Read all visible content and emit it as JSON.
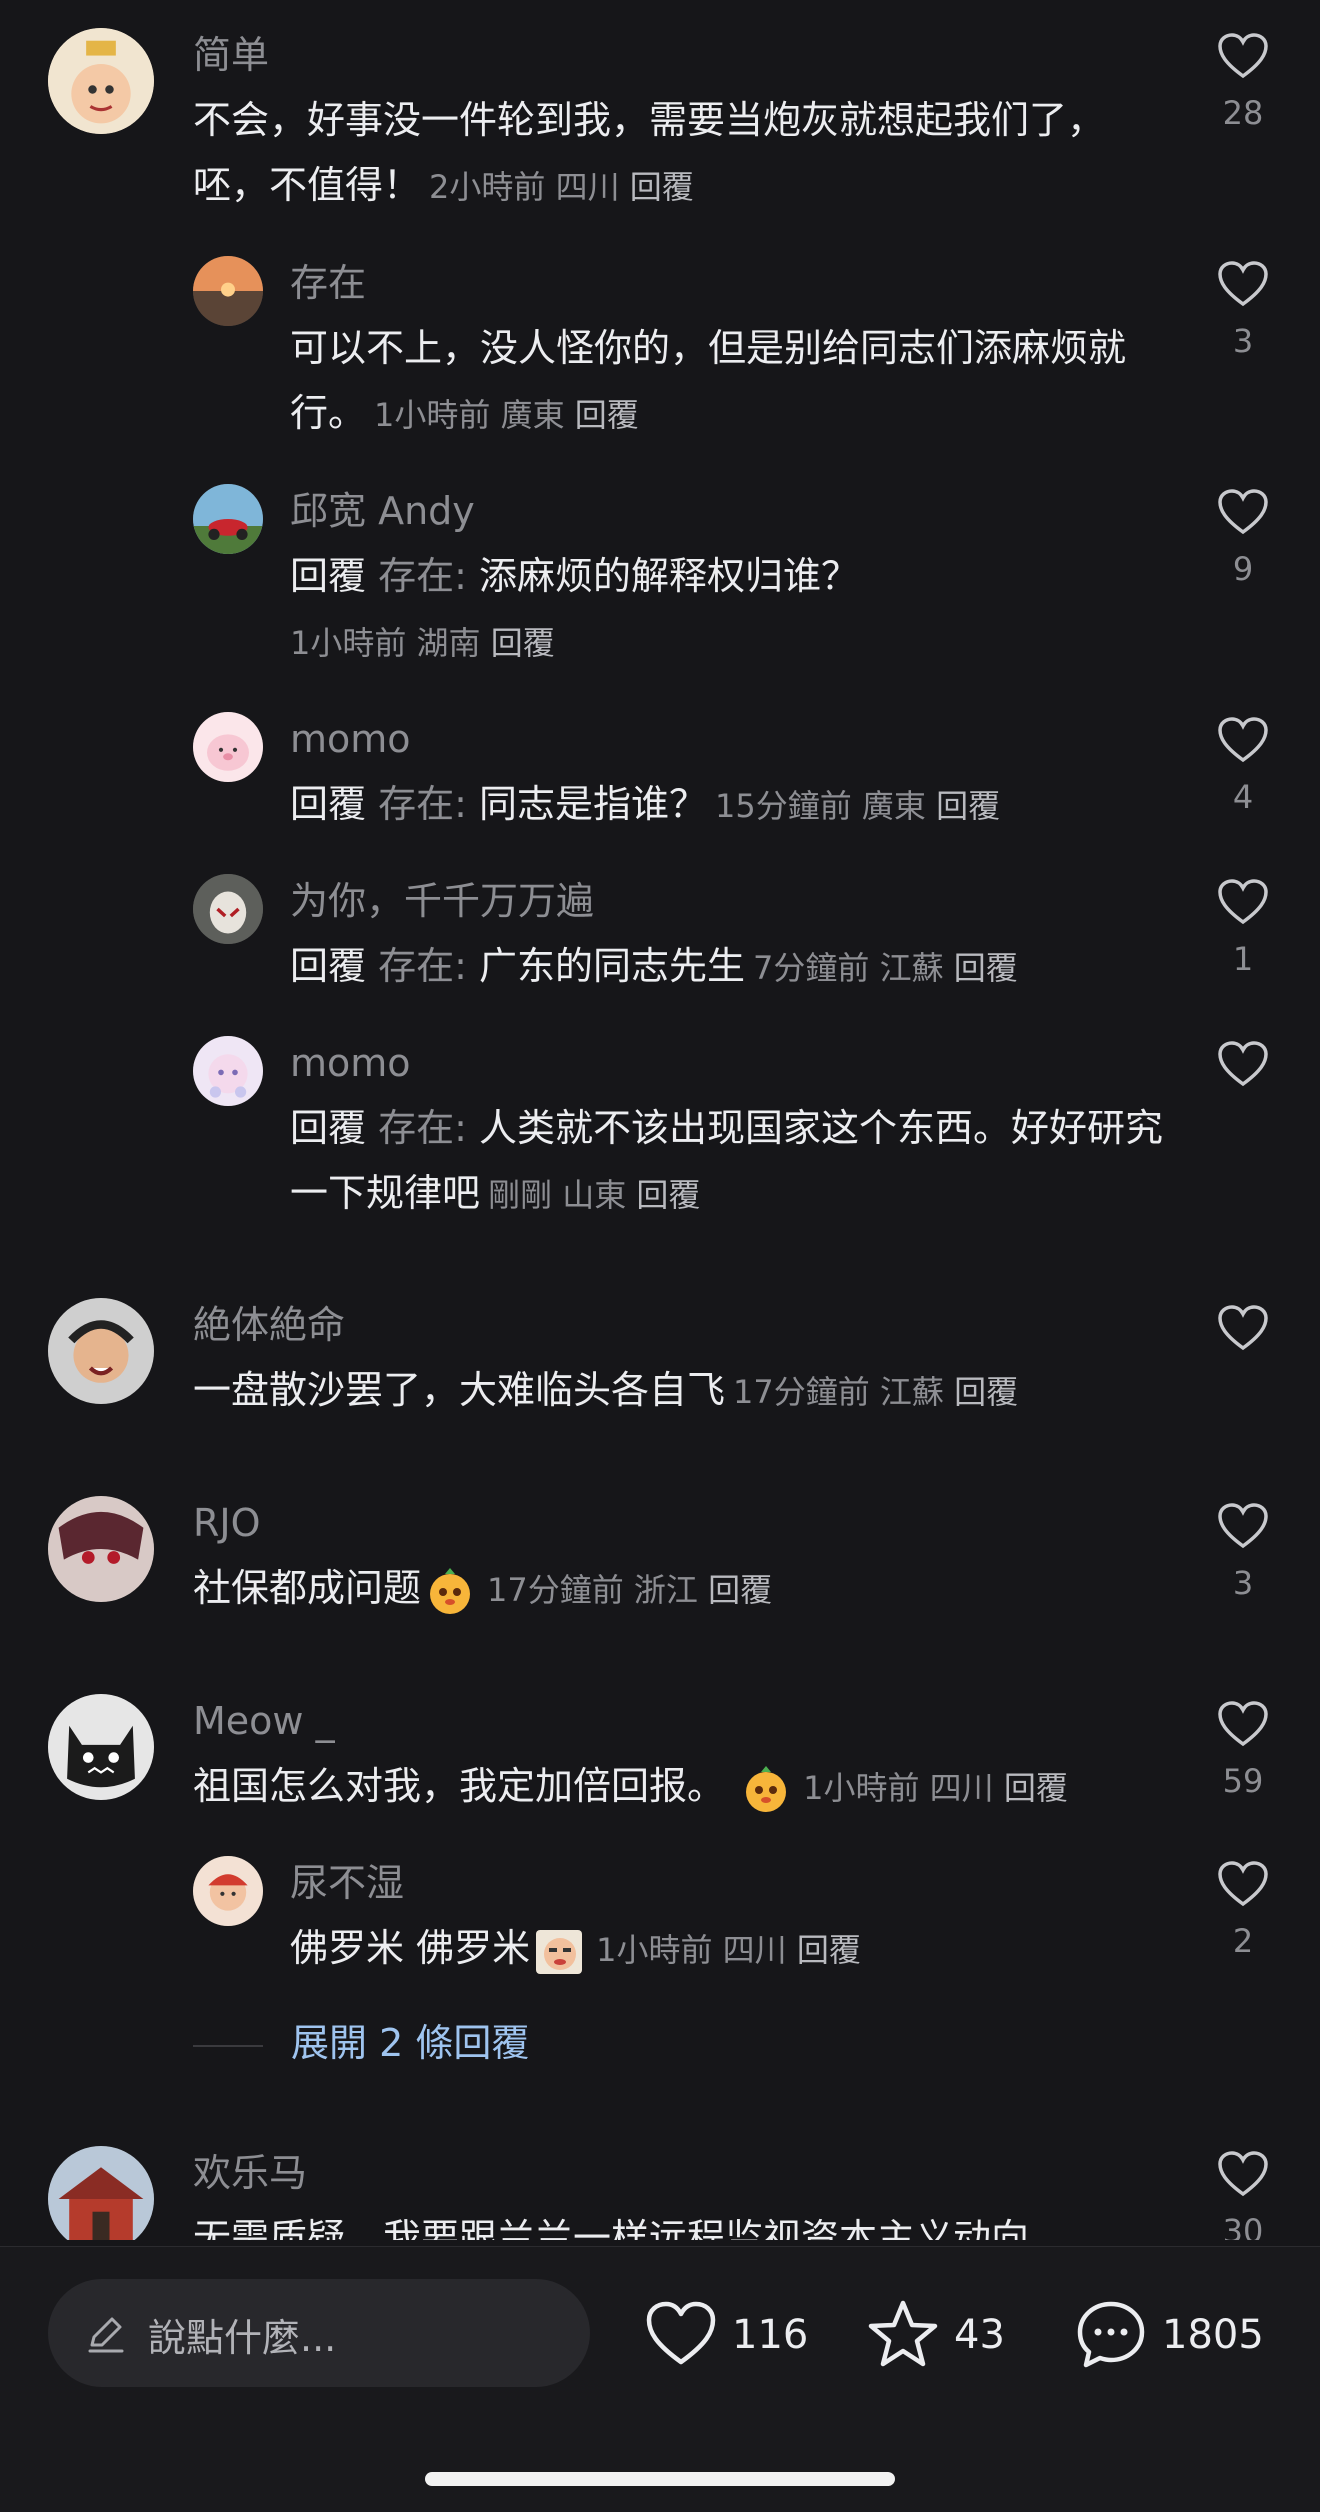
{
  "comments": [
    {
      "name": "简单",
      "text": "不会，好事没一件轮到我，需要当炮灰就想起我们了，呸，不值得！",
      "time": "2小時前",
      "region": "四川",
      "reply": "回覆",
      "likes": "28"
    },
    {
      "name": "存在",
      "text": "可以不上，没人怪你的，但是别给同志们添麻烦就行。",
      "time": "1小時前",
      "region": "廣東",
      "reply": "回覆",
      "likes": "3"
    },
    {
      "name": "邱宽 Andy",
      "prefix": "回覆",
      "target": "存在:",
      "text": " 添麻烦的解释权归谁？",
      "time": "1小時前",
      "region": "湖南",
      "reply": "回覆",
      "likes": "9"
    },
    {
      "name": "momo",
      "prefix": "回覆",
      "target": "存在:",
      "text": " 同志是指谁？",
      "time": "15分鐘前",
      "region": "廣東",
      "reply": "回覆",
      "likes": "4"
    },
    {
      "name": "为你，千千万万遍",
      "prefix": "回覆",
      "target": "存在:",
      "text": " 广东的同志先生",
      "time": "7分鐘前",
      "region": "江蘇",
      "reply": "回覆",
      "likes": "1"
    },
    {
      "name": "momo",
      "prefix": "回覆",
      "target": "存在:",
      "text": " 人类就不该出现国家这个东西。好好研究一下规律吧",
      "time": "剛剛",
      "region": "山東",
      "reply": "回覆",
      "likes": ""
    },
    {
      "name": "絶体絶命",
      "text": "一盘散沙罢了，大难临头各自飞",
      "time": "17分鐘前",
      "region": "江蘇",
      "reply": "回覆",
      "likes": ""
    },
    {
      "name": "RJO",
      "text": "社保都成问题",
      "time": "17分鐘前",
      "region": "浙江",
      "reply": "回覆",
      "likes": "3"
    },
    {
      "name": "Meow _",
      "text": "祖国怎么对我，我定加倍回报。",
      "time": "1小時前",
      "region": "四川",
      "reply": "回覆",
      "likes": "59"
    },
    {
      "name": "尿不湿",
      "text": "佛罗米 佛罗米",
      "time": "1小時前",
      "region": "四川",
      "reply": "回覆",
      "likes": "2"
    },
    {
      "name": "欢乐马",
      "text": "无需质疑，我要跟兰兰一样远程监视资本主义动向",
      "likes": "30"
    }
  ],
  "expand_label": "展開 2 條回覆",
  "bottom": {
    "placeholder": "說點什麼...",
    "likes": "116",
    "favorites": "43",
    "comments": "1805"
  },
  "colors": {
    "background": "#161619",
    "link": "#9fc4ef",
    "muted": "#8d8e93"
  }
}
